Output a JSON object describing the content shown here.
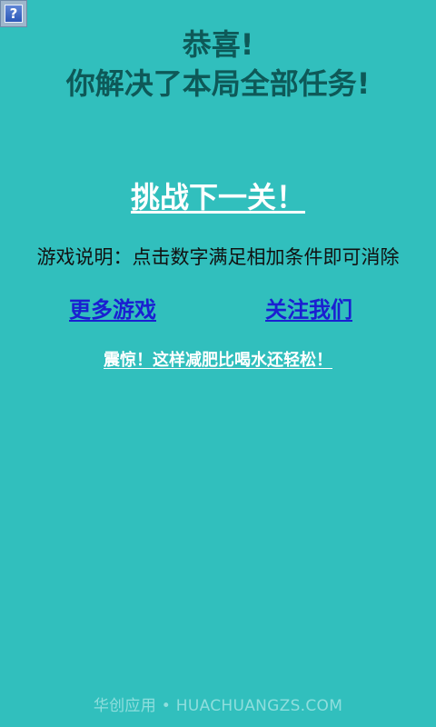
{
  "help_icon": {
    "glyph": "?",
    "icon": "help-icon"
  },
  "title": {
    "line1": "恭喜!",
    "line2": "你解决了本局全部任务!"
  },
  "actions": {
    "next_level": "挑战下一关！"
  },
  "instructions": "游戏说明：点击数字满足相加条件即可消除",
  "links": {
    "more_games": "更多游戏",
    "follow_us": "关注我们"
  },
  "promo": "震惊！这样减肥比喝水还轻松！",
  "watermark": "华创应用 • HUACHUANGZS.COM",
  "colors": {
    "background": "#31bfbd",
    "title": "#0e5958",
    "link": "#1a1fd1",
    "accent_text": "#ffffff"
  }
}
